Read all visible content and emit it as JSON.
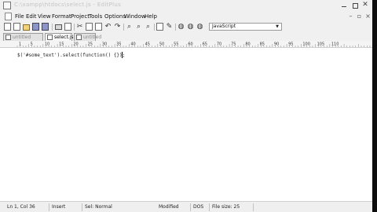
{
  "window": {
    "title": "C:\\xampp\\htdocs\\select.js - EditPlus"
  },
  "menu": {
    "items": [
      "File",
      "Edit",
      "View",
      "Format",
      "Project",
      "Tools",
      "Options",
      "Window",
      "Help"
    ]
  },
  "toolbar": {
    "syntax_value": "JavaScript"
  },
  "tabs": [
    {
      "label": "untitled",
      "active": false
    },
    {
      "label": "select.js *",
      "active": true
    },
    {
      "label": "untitled",
      "active": false
    }
  ],
  "ruler": {
    "labels": [
      "1",
      "5",
      "10",
      "15",
      "20",
      "25",
      "30",
      "35",
      "40",
      "45",
      "50",
      "55",
      "60",
      "65",
      "70",
      "75",
      "80",
      "85",
      "90",
      "95",
      "100",
      "105",
      "110"
    ]
  },
  "editor": {
    "code": "$('#some_text').select(function() {});"
  },
  "status": {
    "position": "Ln 1, Col 36",
    "mode": "Insert",
    "selection": "Sel: Normal",
    "modified": "Modified",
    "format": "DOS",
    "file_size": "File size: 25"
  },
  "colors": {
    "window_bg": "#ececec",
    "editor_bg": "#ffffff",
    "screen_edge": "#0d0d0d"
  },
  "icons": [
    "app-icon",
    "new-file-icon",
    "open-folder-icon",
    "save-icon",
    "print-icon",
    "cut-icon",
    "copy-icon",
    "paste-icon",
    "undo-icon",
    "redo-icon",
    "find-icon",
    "replace-icon",
    "browser-icon"
  ]
}
